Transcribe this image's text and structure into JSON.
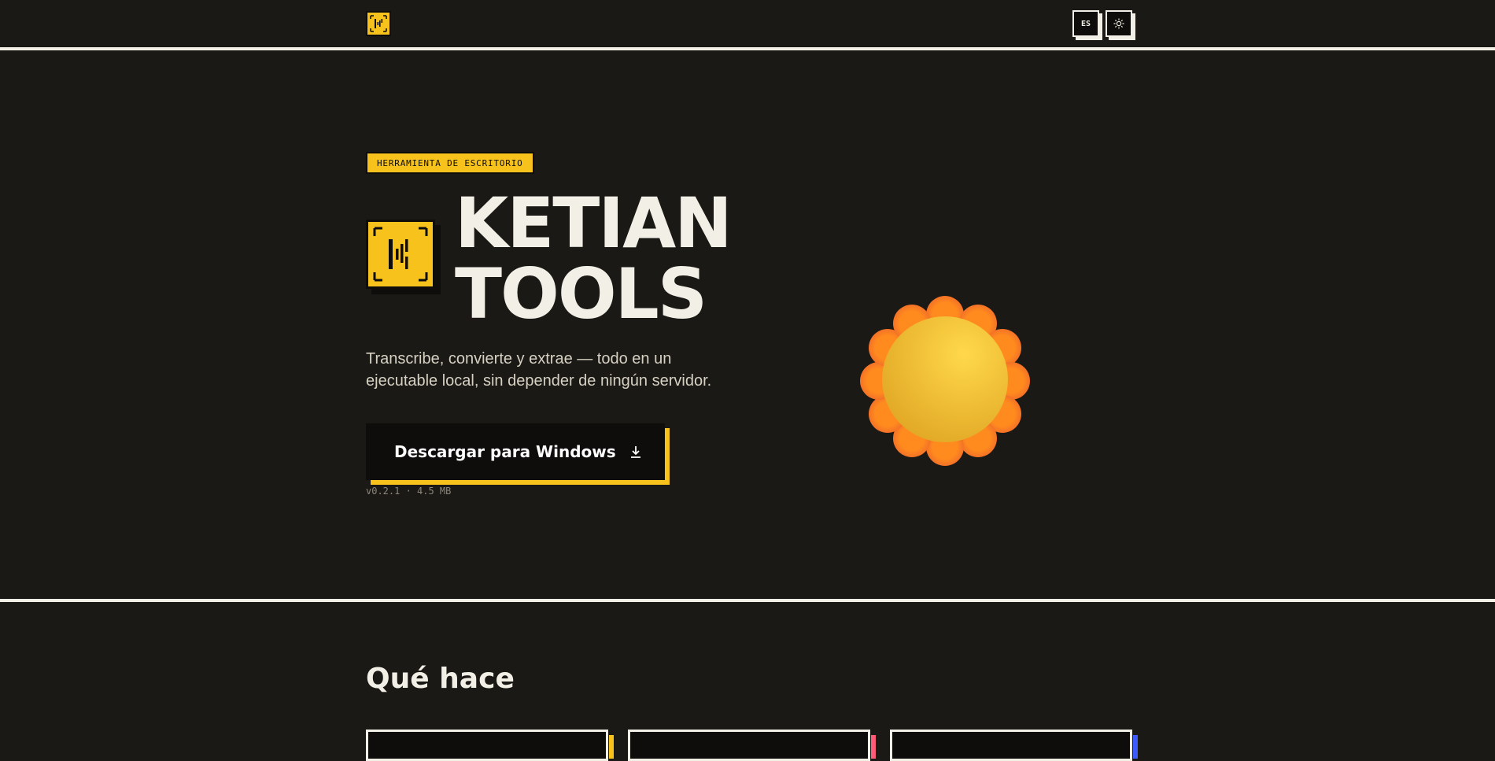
{
  "header": {
    "logo_icon": "ketian-logo-icon",
    "language_label": "ES",
    "theme_icon": "sun-icon"
  },
  "hero": {
    "tag": "HERRAMIENTA DE ESCRITORIO",
    "title_line1": "KETIAN",
    "title_line2": "TOOLS",
    "subtitle": "Transcribe, convierte y extrae — todo en un ejecutable local, sin depender de ningún servidor.",
    "download_label": "Descargar para Windows",
    "download_icon": "download-icon",
    "version": "v0.2.1 · 4.5 MB",
    "illustration": "sun-illustration"
  },
  "features": {
    "title": "Qué hace",
    "card_accents": [
      "#f7c21b",
      "#ff5a78",
      "#3d5cff"
    ]
  },
  "colors": {
    "background": "#1b1915",
    "accent": "#f7c21b",
    "text": "#f2efe6"
  }
}
